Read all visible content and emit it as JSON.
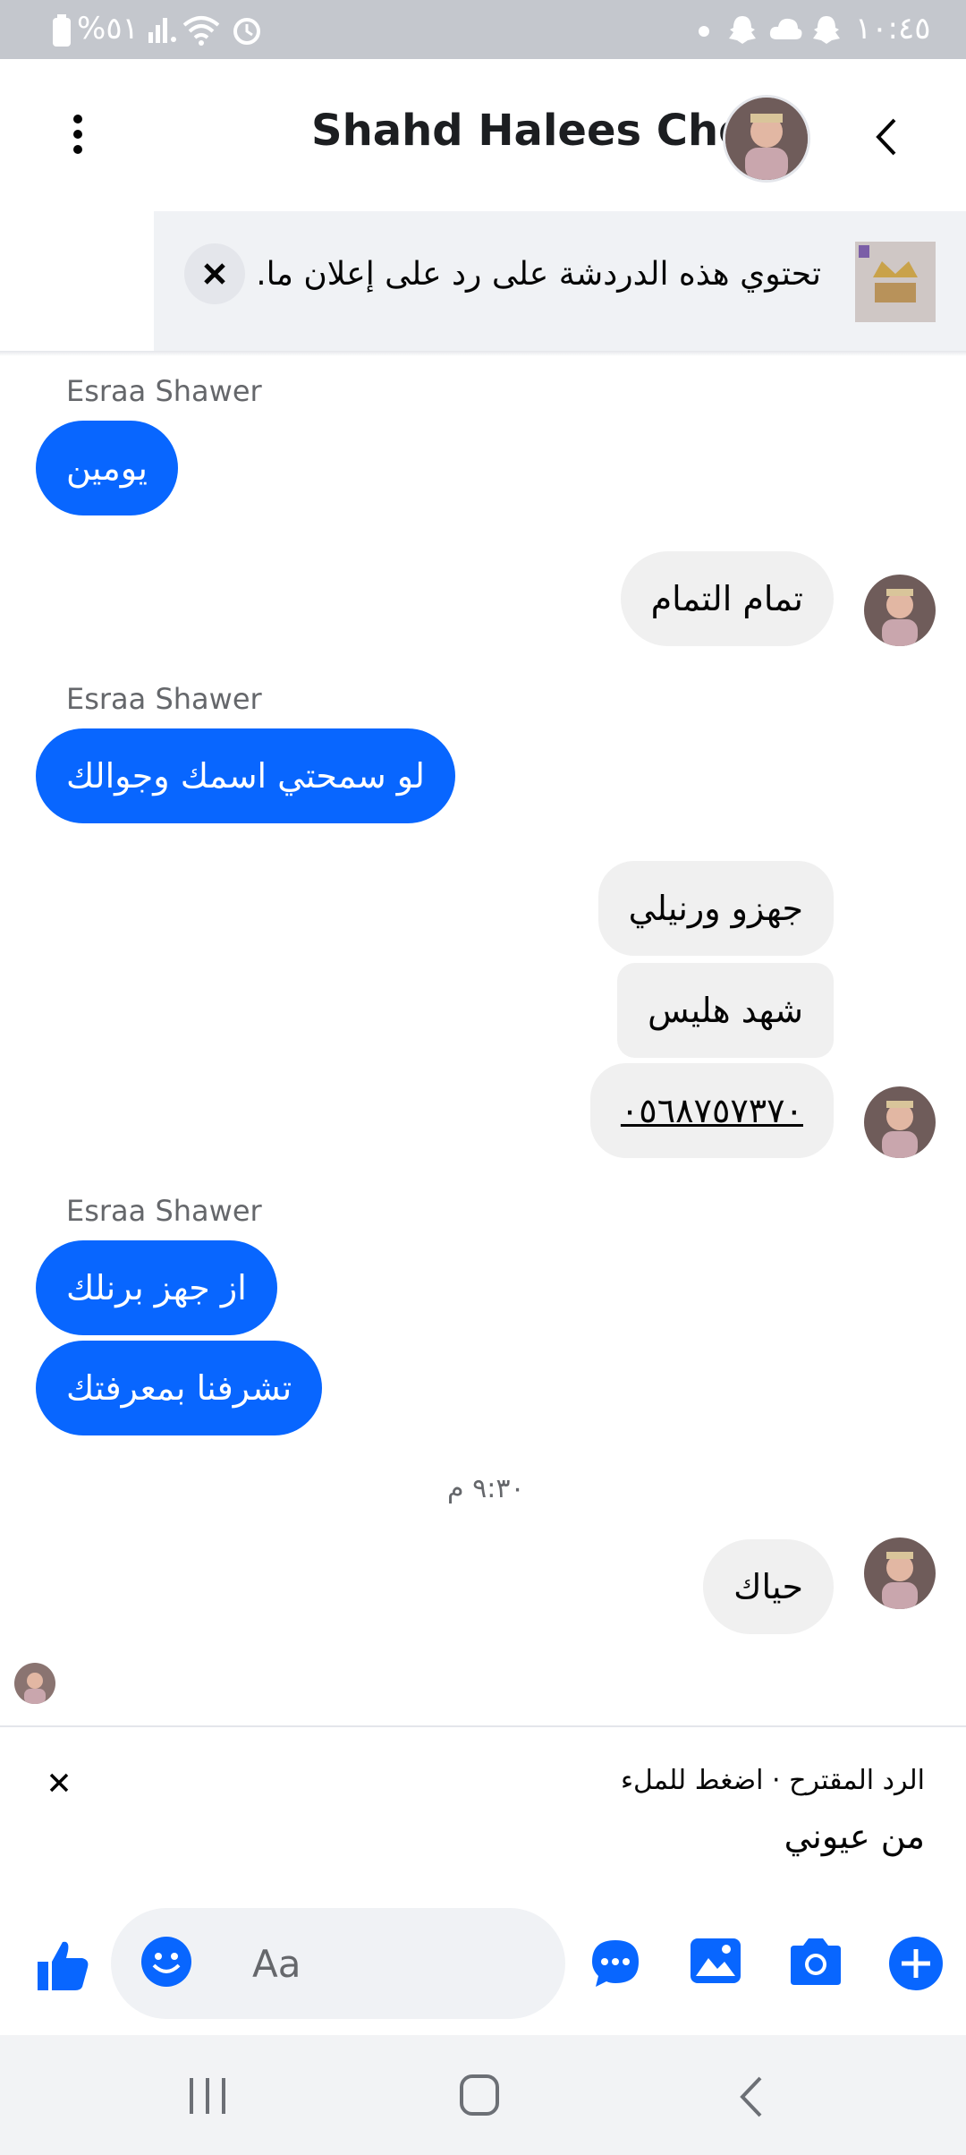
{
  "status_bar": {
    "battery": "%٥١",
    "time": "١٠:٤٥"
  },
  "header": {
    "title": "Shahd Halees Chef"
  },
  "banner": {
    "text": "تحتوي هذه الدردشة على رد على إعلان ما."
  },
  "messages": [
    {
      "sender": "Esraa Shawer",
      "bubbles": [
        "يومين"
      ]
    },
    {
      "bubbles": [
        "تمام التمام"
      ]
    },
    {
      "sender": "Esraa Shawer",
      "bubbles": [
        "لو سمحتي اسمك وجوالك"
      ]
    },
    {
      "bubbles": [
        "جهزو ورنيلي",
        "شهد هليس",
        "٠٥٦٨٧٥٧٣٧٠"
      ]
    },
    {
      "sender": "Esraa Shawer",
      "bubbles": [
        "از جهز برنلك",
        "تشرفنا بمعرفتك"
      ]
    },
    {
      "timestamp": "٩:٣٠ م"
    },
    {
      "bubbles": [
        "حياك"
      ]
    }
  ],
  "suggestion": {
    "label": "الرد المقترح · اضغط للملء",
    "reply": "من عيوني"
  },
  "composer": {
    "placeholder": "Aa"
  },
  "colors": {
    "accent": "#0866ff",
    "incoming_bubble": "#f0f0f0",
    "status_bar": "#c4c7cd"
  }
}
